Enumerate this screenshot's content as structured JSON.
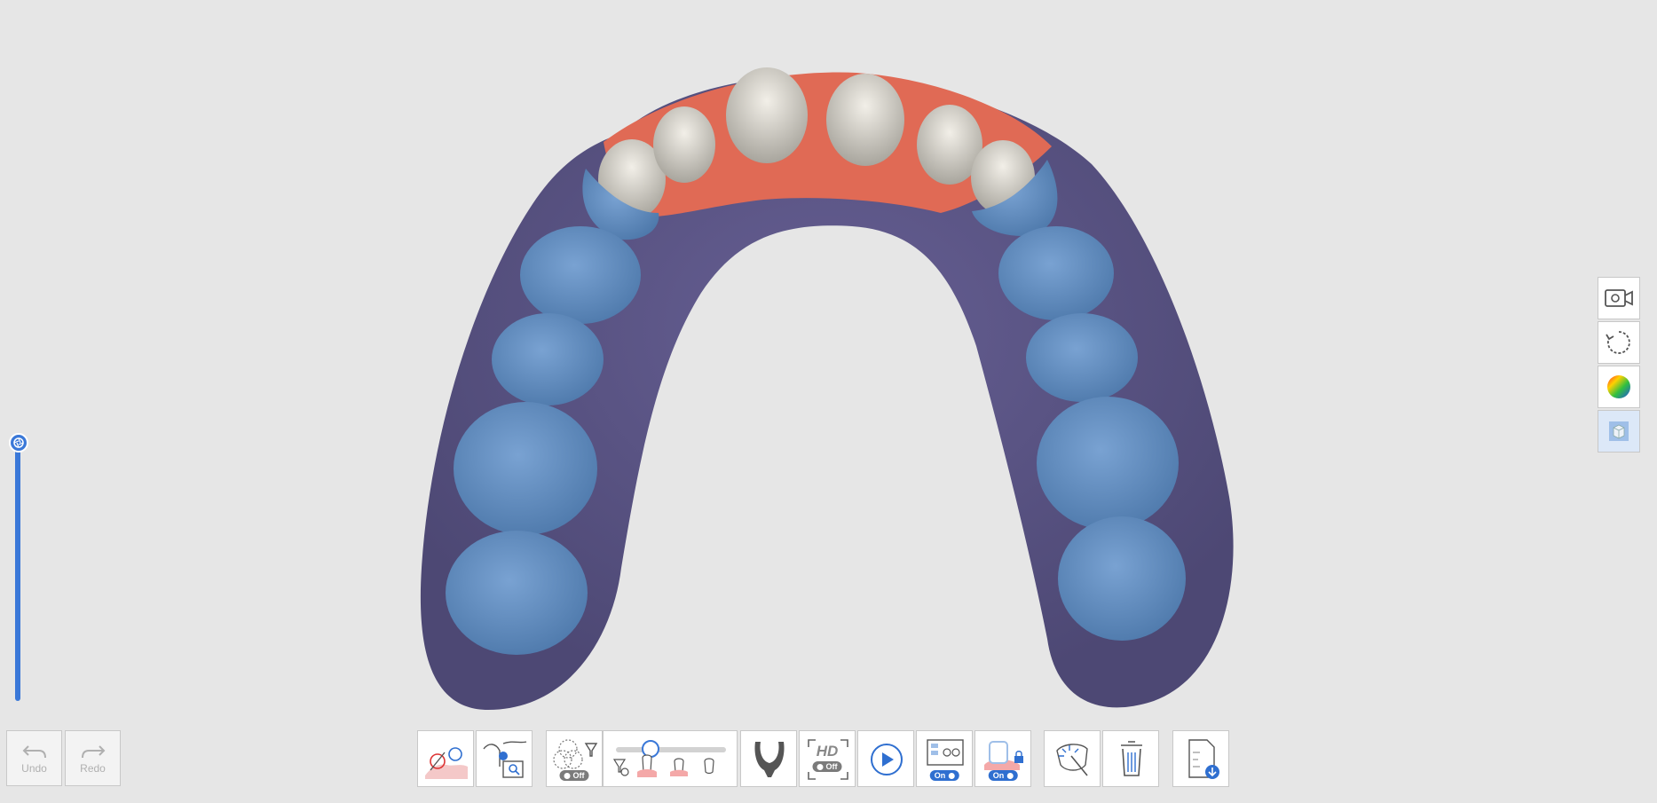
{
  "undo_redo": {
    "undo_label": "Undo",
    "redo_label": "Redo",
    "undo_icon": "undo-arrow-icon",
    "redo_icon": "redo-arrow-icon"
  },
  "right_toolbar": [
    {
      "name": "screen-recording-icon"
    },
    {
      "name": "reset-view-icon"
    },
    {
      "name": "color-map-icon"
    },
    {
      "name": "view-cube-icon"
    }
  ],
  "bottom_toolbar": {
    "tools": [
      {
        "name": "scan-area-filter-icon"
      },
      {
        "name": "scan-data-search-icon"
      },
      {
        "name": "filter-overlap-icon",
        "pill": "Off"
      },
      {
        "name": "data-filter-slider",
        "slider_level_percent": 28
      },
      {
        "name": "arch-shape-icon"
      },
      {
        "name": "hd-scan-icon",
        "text": "HD",
        "pill": "Off"
      },
      {
        "name": "play-icon"
      },
      {
        "name": "dual-view-icon",
        "pill": "On"
      },
      {
        "name": "lock-region-icon",
        "pill": "On"
      },
      {
        "name": "smart-select-icon"
      },
      {
        "name": "trash-icon"
      },
      {
        "name": "export-file-icon"
      }
    ]
  },
  "vertical_slider": {
    "level_percent": 100
  },
  "colors": {
    "background": "#e6e6e6",
    "accent": "#3a78d8",
    "gum": "#5b5684",
    "tooth_blue": "#5f8cc0",
    "tooth_white": "#d9d6cf",
    "gum_red": "#e06a55"
  }
}
